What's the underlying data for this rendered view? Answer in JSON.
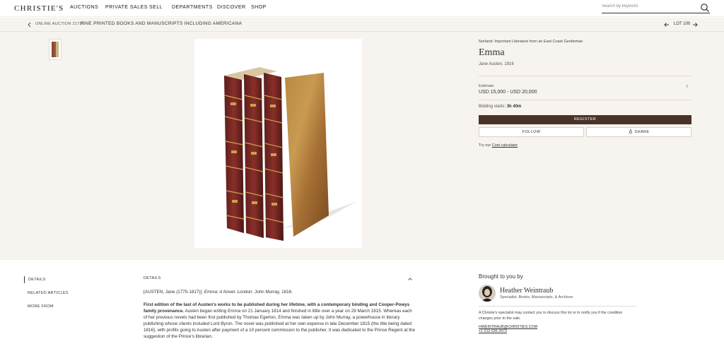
{
  "header": {
    "logo": "CHRISTIE'S",
    "nav": [
      "AUCTIONS",
      "PRIVATE SALES",
      "SELL",
      "DEPARTMENTS",
      "DISCOVER",
      "SHOP"
    ],
    "search_placeholder": "Search by keyword",
    "search_icon": "search-icon"
  },
  "breadcrumb": {
    "sale": "ONLINE AUCTION 21736",
    "title": "FINE PRINTED BOOKS AND MANUSCRIPTS INCLUDING AMERICANA",
    "lot": "LOT 100"
  },
  "lot": {
    "collection": "Norland: Important Literature from an East Coast Gentleman",
    "title": "Emma",
    "subtitle": "Jane Austen, 1816",
    "estimate_label": "Estimate",
    "estimate_value": "USD 15,000 - USD 20,000",
    "estimate_help": "?",
    "bidding_label": "Bidding starts:",
    "bidding_value": "3h 40m",
    "register_label": "REGISTER",
    "follow_label": "FOLLOW",
    "share_label": "SHARE",
    "cost_prefix": "Try our",
    "cost_link": "Cost calculator"
  },
  "tabs": [
    "DETAILS",
    "RELATED ARTICLES",
    "MORE FROM"
  ],
  "details": {
    "heading": "DETAILS",
    "line1_prefix": "[AUSTEN, Jane (1775-1817)].",
    "line1_italic": "Emma: A Novel",
    "line1_suffix": ". London: John Murray, 1816.",
    "para_bold": "First edition of the last of Austen's works to be published during her lifetime, with a contemporary binding and Cooper-Powys family provenance.",
    "para_a": " Austen began writing ",
    "para_italic": "Emma",
    "para_b": " on 21 January 1814 and finished in little over a year on 29 March 1815. Whereas each of her previous novels had been first published by Thomas Egerton, Emma was taken up by John Murray, a powerhouse in literary publishing whose clients included Lord Byron. The novel was published at her own expense in late December 1815 (the title being dated 1816), with profits going to Austen after payment of a 10 percent commission to the publisher. It was dedicated to the Prince Regent at the suggestion of the Prince's librarian."
  },
  "specialist": {
    "heading": "Brought to you by",
    "name": "Heather Weintraub",
    "dept": "Specialist, Books, Manuscripts, & Archives",
    "note": "A Christie's specialist may contact you to discuss this lot or to notify you if the condition changes prior to the sale.",
    "email": "HWEINTRAUB@CHRISTIES.COM",
    "phone": "+1 212 636 2673"
  },
  "colors": {
    "accent": "#4a3228",
    "hero_bg": "#f7f3ef"
  }
}
